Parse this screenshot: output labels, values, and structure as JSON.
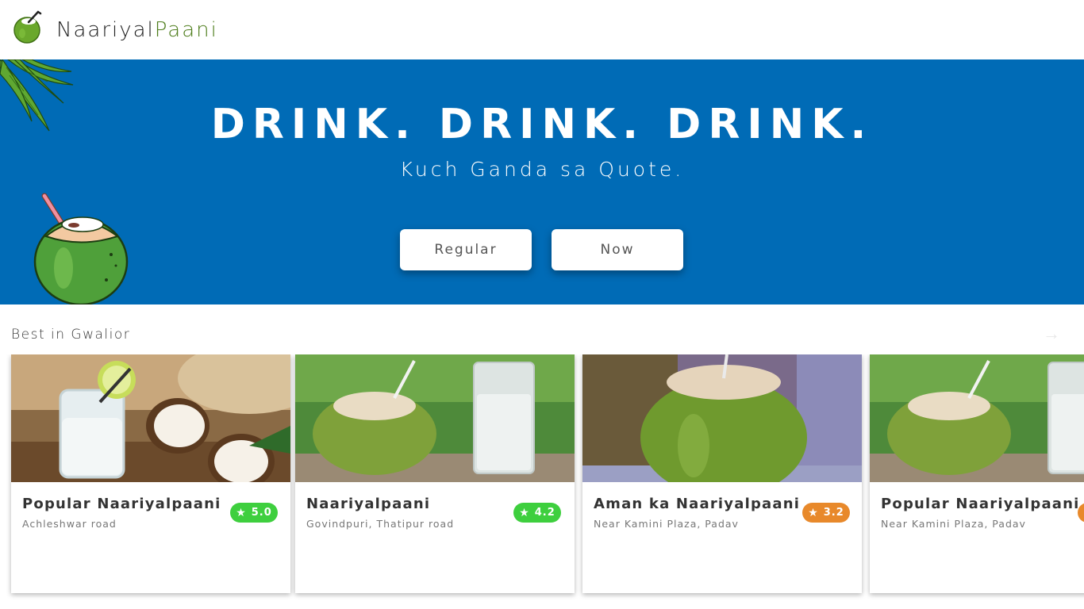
{
  "brand": {
    "name_main": "Naariyal",
    "name_accent": "Paani",
    "accent_color": "#4e7d1c",
    "icon": "coconut-logo-icon"
  },
  "hero": {
    "title": "DRINK. DRINK. DRINK.",
    "subtitle": "Kuch Ganda sa Quote.",
    "background": "#006bb6",
    "buttons": [
      {
        "label": "Regular"
      },
      {
        "label": "Now"
      }
    ]
  },
  "section": {
    "title": "Best in Gwalior",
    "arrow": "→"
  },
  "cards": [
    {
      "name": "Popular Naariyalpaani",
      "address": "Achleshwar road",
      "rating": "5.0",
      "rating_color": "green"
    },
    {
      "name": "Naariyalpaani",
      "address": "Govindpuri, Thatipur road",
      "rating": "4.2",
      "rating_color": "green"
    },
    {
      "name": "Aman ka Naariyalpaani",
      "address": "Near Kamini Plaza, Padav",
      "rating": "3.2",
      "rating_color": "orange"
    },
    {
      "name": "Popular Naariyalpaani",
      "address": "Near Kamini Plaza, Padav",
      "rating": "",
      "rating_color": "orange"
    }
  ]
}
